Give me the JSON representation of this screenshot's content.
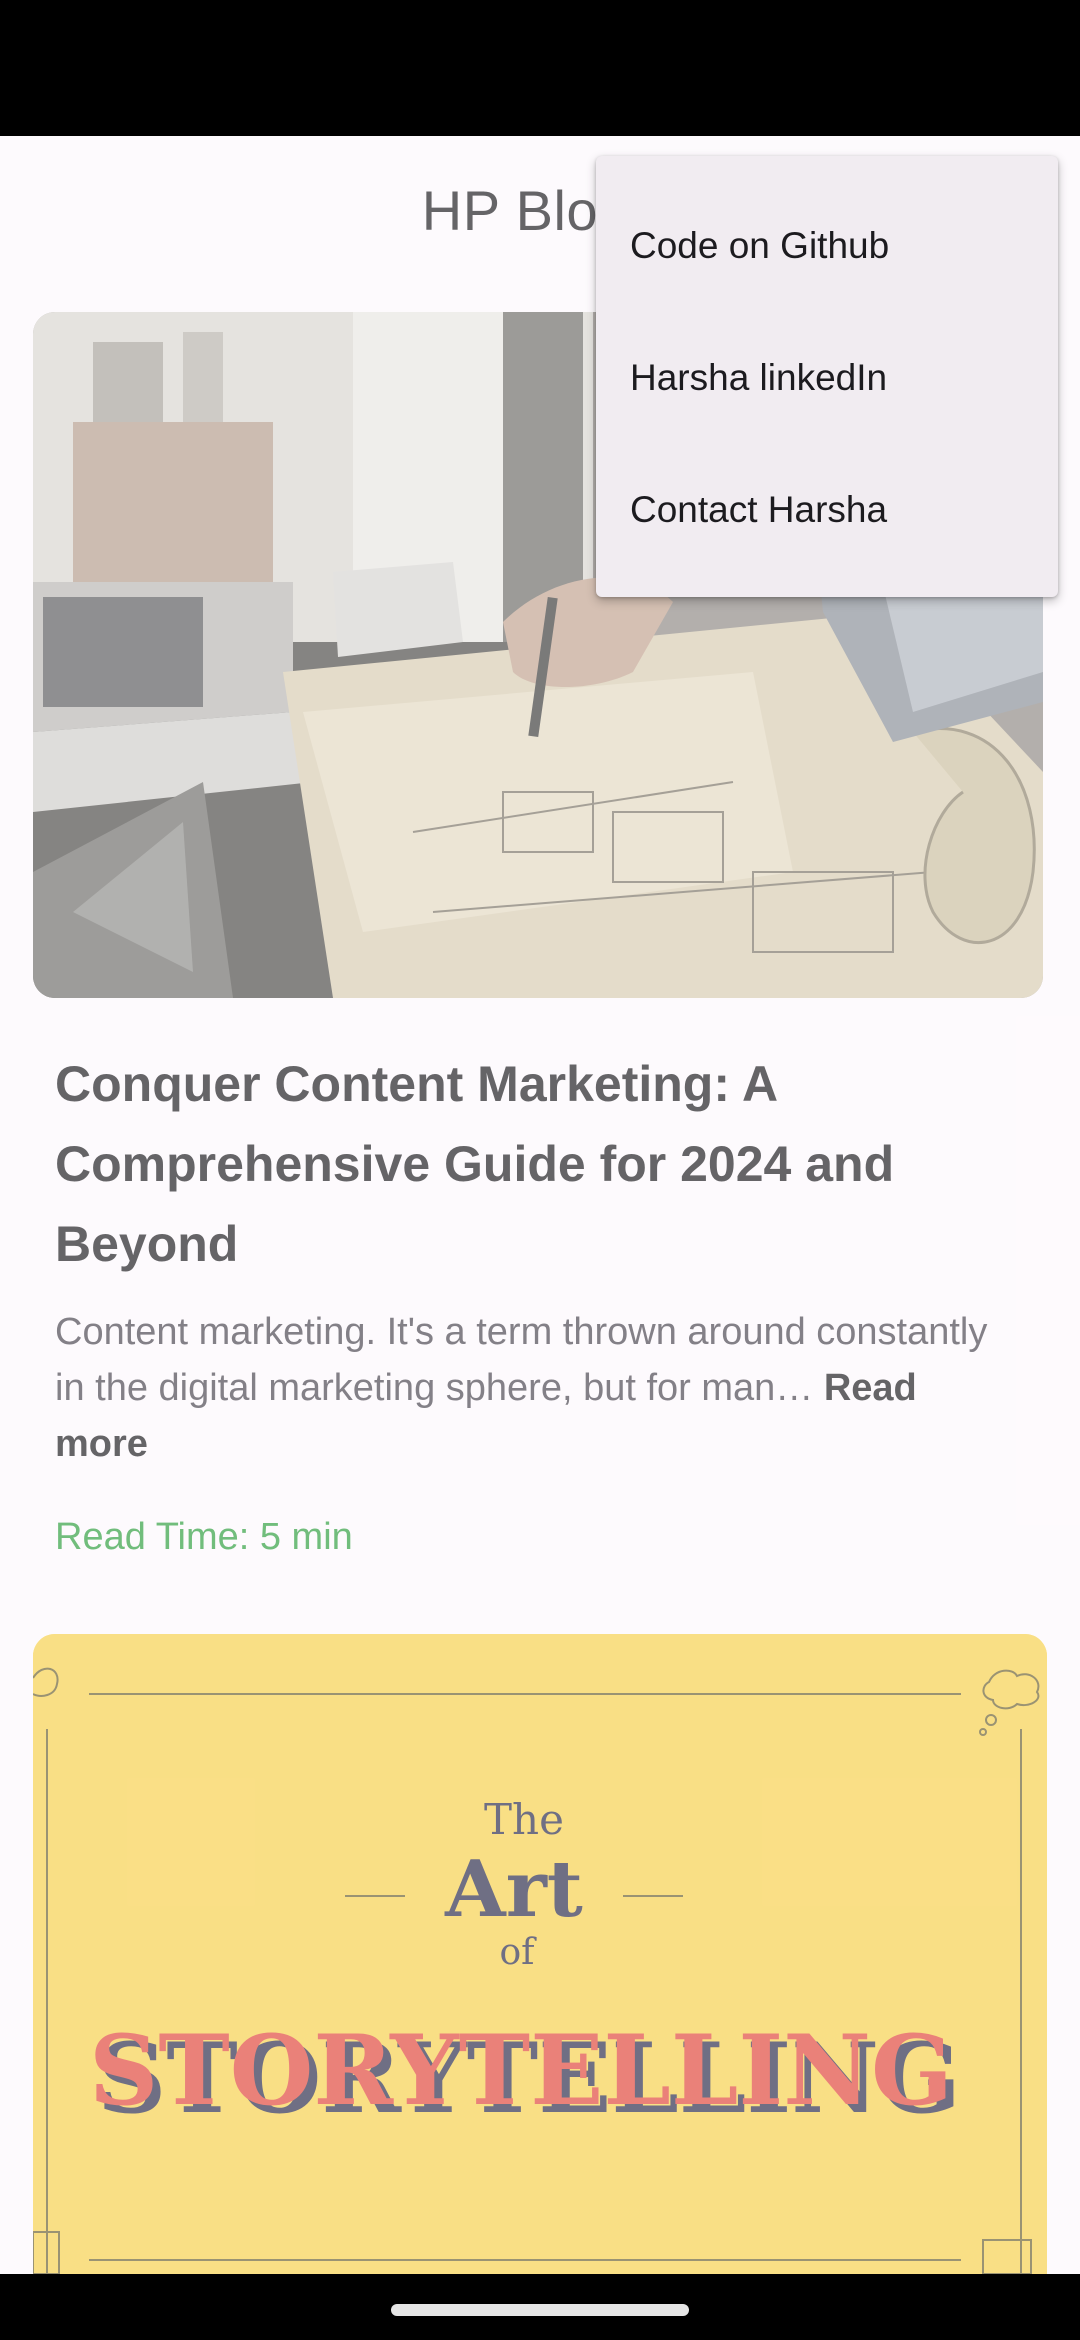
{
  "app": {
    "title": "HP Blogs"
  },
  "menu": {
    "items": [
      {
        "label": "Code on Github"
      },
      {
        "label": "Harsha linkedIn"
      },
      {
        "label": "Contact Harsha"
      }
    ]
  },
  "posts": [
    {
      "title": "Conquer Content Marketing: A Comprehensive Guide for 2024 and Beyond",
      "excerpt": "Content marketing. It's a term thrown around constantly in the digital marketing sphere, but for man… ",
      "read_more": "Read more",
      "read_time": "Read Time: 5 min",
      "image_icon": "architect-desk-photo"
    },
    {
      "image_icon": "storytelling-poster",
      "image_text": {
        "line1": "The",
        "line2": "Art",
        "line3": "of",
        "line4": "STORYTELLING"
      }
    }
  ],
  "colors": {
    "background": "#fdf8fc",
    "read_time": "#2e9e3e",
    "menu_bg": "#f1ecf1",
    "poster_bg": "#f7d04c"
  }
}
